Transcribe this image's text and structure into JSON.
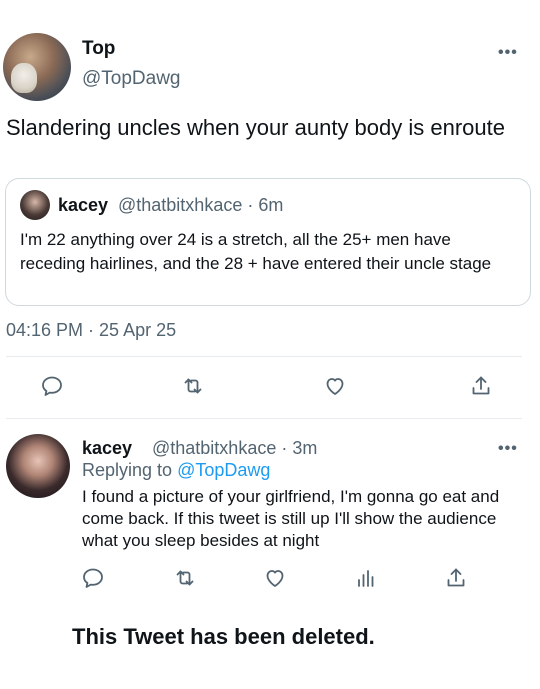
{
  "main_tweet": {
    "display_name": "Top",
    "handle": "@TopDawg",
    "text": "Slandering uncles when your aunty body is enroute",
    "timestamp": "04:16 PM · 25 Apr 25"
  },
  "quoted_tweet": {
    "display_name": "kacey",
    "meta": "@thatbitxhkace · 6m",
    "text": "I'm 22 anything over 24 is a stretch, all the 25+ men have receding hairlines, and the 28 + have entered their uncle stage"
  },
  "reply_tweet": {
    "display_name": "kacey",
    "meta": "@thatbitxhkace · 3m",
    "replying_prefix": "Replying to ",
    "replying_handle": "@TopDawg",
    "text": "I found a picture of your girlfriend, I'm gonna go eat and come back. If this tweet is still up I'll show the audience what you sleep besides at night"
  },
  "more_menu_glyph": "•••",
  "deleted_notice": "This Tweet has been deleted.",
  "icons": {
    "reply": "comment-icon",
    "retweet": "retweet-icon",
    "like": "heart-icon",
    "share": "share-icon",
    "analytics": "analytics-icon"
  },
  "colors": {
    "text": "#0f1419",
    "secondary": "#536471",
    "link": "#1d9bf0",
    "border": "#cfd9de"
  }
}
